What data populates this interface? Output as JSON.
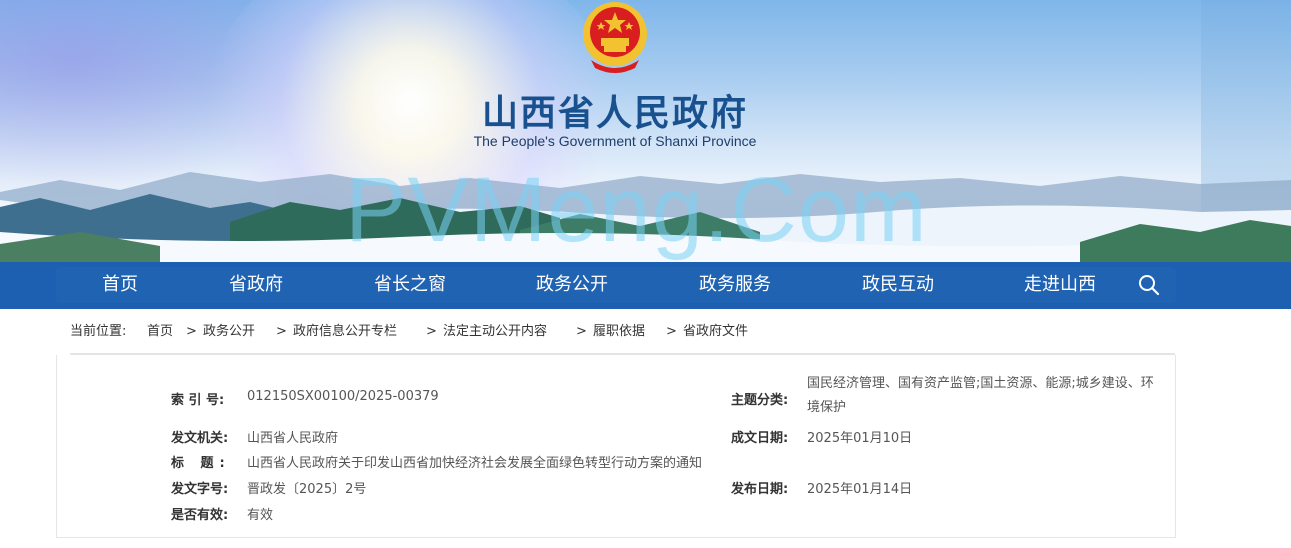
{
  "header": {
    "title": "山西省人民政府",
    "subtitle": "The People's Government of Shanxi Province",
    "watermark": "PVMeng.Com",
    "emblem_icon": "national-emblem-icon"
  },
  "nav": {
    "items": [
      {
        "label": "首页"
      },
      {
        "label": "省政府"
      },
      {
        "label": "省长之窗"
      },
      {
        "label": "政务公开"
      },
      {
        "label": "政务服务"
      },
      {
        "label": "政民互动"
      },
      {
        "label": "走进山西"
      }
    ],
    "search_icon": "search-icon"
  },
  "breadcrumb": {
    "prefix": "当前位置:",
    "items": [
      "首页",
      "政务公开",
      "政府信息公开专栏",
      "法定主动公开内容",
      "履职依据",
      "省政府文件"
    ],
    "separator": ">"
  },
  "info": {
    "index_label": "索 引 号:",
    "index_value": "012150SX00100/2025-00379",
    "topic_label": "主题分类:",
    "topic_value": "国民经济管理、国有资产监管;国土资源、能源;城乡建设、环境保护",
    "issuer_label": "发文机关:",
    "issuer_value": "山西省人民政府",
    "created_label": "成文日期:",
    "created_value": "2025年01月10日",
    "title_label": "标 题:",
    "title_value": "山西省人民政府关于印发山西省加快经济社会发展全面绿色转型行动方案的通知",
    "docno_label": "发文字号:",
    "docno_value": "晋政发〔2025〕2号",
    "published_label": "发布日期:",
    "published_value": "2025年01月14日",
    "valid_label": "是否有效:",
    "valid_value": "有效"
  },
  "colors": {
    "nav_bg": "#1d5fb0",
    "title_blue": "#19518f",
    "emblem_red": "#d81e1e",
    "emblem_gold": "#f2c230"
  }
}
